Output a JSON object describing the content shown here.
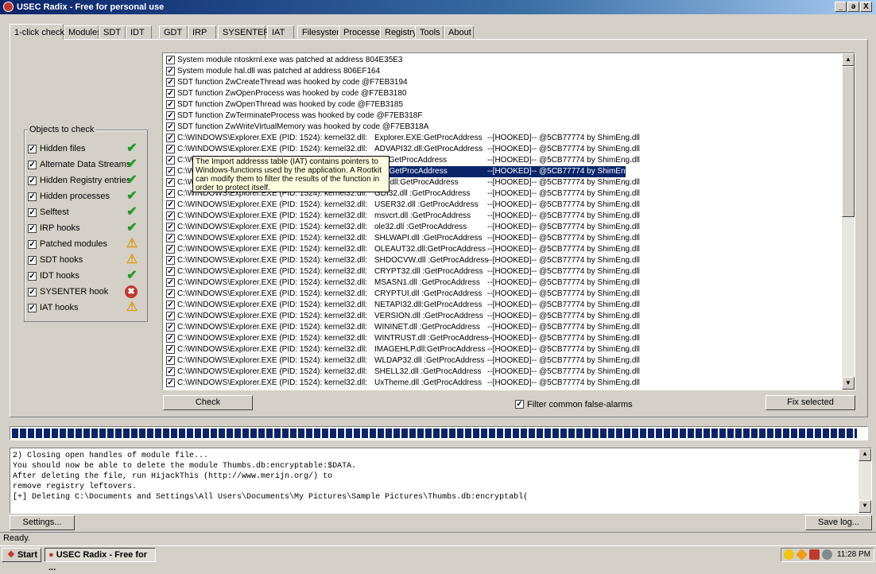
{
  "window": {
    "title": "USEC Radix - Free for personal use",
    "controls": [
      "_",
      "ə",
      "X"
    ]
  },
  "tabs": [
    "1-click check",
    "Modules",
    "SDT",
    "IDT",
    "GDT",
    "IRP",
    "SYSENTER",
    "IAT",
    "Filesystem",
    "Processes",
    "Registry",
    "Tools",
    "About"
  ],
  "objects": {
    "legend": "Objects to check",
    "items": [
      {
        "label": "Hidden files",
        "status": "ok"
      },
      {
        "label": "Alternate Data Streams",
        "status": "ok"
      },
      {
        "label": "Hidden Registry entries",
        "status": "ok"
      },
      {
        "label": "Hidden processes",
        "status": "ok"
      },
      {
        "label": "Selftest",
        "status": "ok"
      },
      {
        "label": "IRP hooks",
        "status": "ok"
      },
      {
        "label": "Patched modules",
        "status": "warn"
      },
      {
        "label": "SDT hooks",
        "status": "warn"
      },
      {
        "label": "IDT hooks",
        "status": "ok"
      },
      {
        "label": "SYSENTER hook",
        "status": "error"
      },
      {
        "label": "IAT hooks",
        "status": "warn"
      }
    ]
  },
  "results": [
    {
      "c1": "System module ntoskrnl.exe was patched at address 804E35E3",
      "c2": "",
      "c3": ""
    },
    {
      "c1": "System module hal.dll was patched at address 806EF164",
      "c2": "",
      "c3": ""
    },
    {
      "c1": "SDT function ZwCreateThread was hooked by code @F7EB3194",
      "c2": "",
      "c3": ""
    },
    {
      "c1": "SDT function ZwOpenProcess was hooked by code @F7EB3180",
      "c2": "",
      "c3": ""
    },
    {
      "c1": "SDT function ZwOpenThread was hooked by code @F7EB3185",
      "c2": "",
      "c3": ""
    },
    {
      "c1": "SDT function ZwTerminateProcess was hooked by code @F7EB318F",
      "c2": "",
      "c3": ""
    },
    {
      "c1": "SDT function ZwWriteVirtualMemory was hooked by code @F7EB318A",
      "c2": "",
      "c3": ""
    },
    {
      "c1": "C:\\WINDOWS\\Explorer.EXE (PID: 1524): kernel32.dll:",
      "c2": "Explorer.EXE:GetProcAddress",
      "c3": "--[HOOKED]-- @5CB77774 by ShimEng.dll"
    },
    {
      "c1": "C:\\WINDOWS\\Explorer.EXE (PID: 1524): kernel32.dll:",
      "c2": "ADVAPI32.dll:GetProcAddress",
      "c3": "--[HOOKED]-- @5CB77774 by ShimEng.dll"
    },
    {
      "c1": "C:\\WINDOWS\\Explorer.EXE (PID: 1524): kernel32.dll:",
      "c2": "l.dll:GetProcAddress",
      "c3": "--[HOOKED]-- @5CB77774 by ShimEng.dll"
    },
    {
      "c1": "C:\\W",
      "c2": ".dll :GetProcAddress",
      "c3": "--[HOOKED]-- @5CB77774 by ShimEng.dll"
    },
    {
      "c1": "C:\\W",
      "c2": "EUI.dll:GetProcAddress",
      "c3": "--[HOOKED]-- @5CB77774 by ShimEng.dll"
    },
    {
      "c1": "C:\\WINDOWS\\Explorer.EXE (PID: 1524): kernel32.dll:",
      "c2": "GDI32.dll :GetProcAddress",
      "c3": "--[HOOKED]-- @5CB77774 by ShimEng.dll"
    },
    {
      "c1": "C:\\WINDOWS\\Explorer.EXE (PID: 1524): kernel32.dll:",
      "c2": "USER32.dll :GetProcAddress",
      "c3": "--[HOOKED]-- @5CB77774 by ShimEng.dll"
    },
    {
      "c1": "C:\\WINDOWS\\Explorer.EXE (PID: 1524): kernel32.dll:",
      "c2": "msvcrt.dll :GetProcAddress",
      "c3": "--[HOOKED]-- @5CB77774 by ShimEng.dll"
    },
    {
      "c1": "C:\\WINDOWS\\Explorer.EXE (PID: 1524): kernel32.dll:",
      "c2": "ole32.dll :GetProcAddress",
      "c3": "--[HOOKED]-- @5CB77774 by ShimEng.dll"
    },
    {
      "c1": "C:\\WINDOWS\\Explorer.EXE (PID: 1524): kernel32.dll:",
      "c2": "SHLWAPI.dll :GetProcAddress",
      "c3": "--[HOOKED]-- @5CB77774 by ShimEng.dll"
    },
    {
      "c1": "C:\\WINDOWS\\Explorer.EXE (PID: 1524): kernel32.dll:",
      "c2": "OLEAUT32.dll:GetProcAddress",
      "c3": "--[HOOKED]-- @5CB77774 by ShimEng.dll"
    },
    {
      "c1": "C:\\WINDOWS\\Explorer.EXE (PID: 1524): kernel32.dll:",
      "c2": "SHDOCVW.dll :GetProcAddress",
      "c3": "--[HOOKED]-- @5CB77774 by ShimEng.dll"
    },
    {
      "c1": "C:\\WINDOWS\\Explorer.EXE (PID: 1524): kernel32.dll:",
      "c2": "CRYPT32.dll :GetProcAddress",
      "c3": "--[HOOKED]-- @5CB77774 by ShimEng.dll"
    },
    {
      "c1": "C:\\WINDOWS\\Explorer.EXE (PID: 1524): kernel32.dll:",
      "c2": "MSASN1.dll :GetProcAddress",
      "c3": "--[HOOKED]-- @5CB77774 by ShimEng.dll"
    },
    {
      "c1": "C:\\WINDOWS\\Explorer.EXE (PID: 1524): kernel32.dll:",
      "c2": "CRYPTUI.dll :GetProcAddress",
      "c3": "--[HOOKED]-- @5CB77774 by ShimEng.dll"
    },
    {
      "c1": "C:\\WINDOWS\\Explorer.EXE (PID: 1524): kernel32.dll:",
      "c2": "NETAPI32.dll:GetProcAddress",
      "c3": "--[HOOKED]-- @5CB77774 by ShimEng.dll"
    },
    {
      "c1": "C:\\WINDOWS\\Explorer.EXE (PID: 1524): kernel32.dll:",
      "c2": "VERSION.dll :GetProcAddress",
      "c3": "--[HOOKED]-- @5CB77774 by ShimEng.dll"
    },
    {
      "c1": "C:\\WINDOWS\\Explorer.EXE (PID: 1524): kernel32.dll:",
      "c2": "WININET.dll :GetProcAddress",
      "c3": "--[HOOKED]-- @5CB77774 by ShimEng.dll"
    },
    {
      "c1": "C:\\WINDOWS\\Explorer.EXE (PID: 1524): kernel32.dll:",
      "c2": "WINTRUST.dll :GetProcAddress",
      "c3": "--[HOOKED]-- @5CB77774 by ShimEng.dll"
    },
    {
      "c1": "C:\\WINDOWS\\Explorer.EXE (PID: 1524): kernel32.dll:",
      "c2": "IMAGEHLP.dll:GetProcAddress",
      "c3": "--[HOOKED]-- @5CB77774 by ShimEng.dll"
    },
    {
      "c1": "C:\\WINDOWS\\Explorer.EXE (PID: 1524): kernel32.dll:",
      "c2": "WLDAP32.dll :GetProcAddress",
      "c3": "--[HOOKED]-- @5CB77774 by ShimEng.dll"
    },
    {
      "c1": "C:\\WINDOWS\\Explorer.EXE (PID: 1524): kernel32.dll:",
      "c2": "SHELL32.dll :GetProcAddress",
      "c3": "--[HOOKED]-- @5CB77774 by ShimEng.dll"
    },
    {
      "c1": "C:\\WINDOWS\\Explorer.EXE (PID: 1524): kernel32.dll:",
      "c2": "UxTheme.dll :GetProcAddress",
      "c3": "--[HOOKED]-- @5CB77774 by ShimEng.dll"
    }
  ],
  "selected_row": 10,
  "tooltip": "The Import addresss table (IAT) contains pointers to Windows-functions used by the application. A Rootkit can modify them to filter the results of the function in order to protect itself.",
  "buttons": {
    "check": "Check",
    "fix": "Fix selected",
    "settings": "Settings...",
    "savelog": "Save log..."
  },
  "filter": {
    "label": "Filter common false-alarms",
    "checked": true
  },
  "progress": 0.99,
  "log": [
    "2) Closing open handles of module file...",
    "You should now be able to delete the module Thumbs.db:encryptable:$DATA.",
    "After deleting the file, run HijackThis (http://www.merijn.org/) to",
    "remove registry leftovers.",
    "[+] Deleting C:\\Documents and Settings\\All Users\\Documents\\My Pictures\\Sample Pictures\\Thumbs.db:encryptabl("
  ],
  "status": "Ready.",
  "taskbar": {
    "start": "Start",
    "task": "USEC Radix - Free for ...",
    "clock": "11:28 PM"
  },
  "colors": {
    "accent": "#0a246a",
    "ok": "#1f9a1f",
    "warn": "#d4a017",
    "error": "#c0392b"
  }
}
